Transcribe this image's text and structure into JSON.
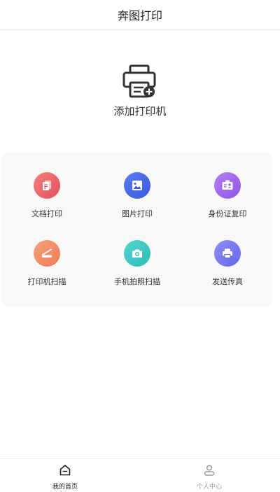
{
  "header": {
    "title": "奔图打印"
  },
  "add_printer": {
    "label": "添加打印机",
    "icon": "printer-add-icon"
  },
  "features": [
    {
      "label": "文档打印",
      "icon": "document-icon",
      "color_from": "#f77f7f",
      "color_to": "#e2505a"
    },
    {
      "label": "图片打印",
      "icon": "image-icon",
      "color_from": "#5b7cf2",
      "color_to": "#3a58de"
    },
    {
      "label": "身份证复印",
      "icon": "id-card-icon",
      "color_from": "#b57ff2",
      "color_to": "#8f55e4"
    },
    {
      "label": "打印机扫描",
      "icon": "scanner-icon",
      "color_from": "#f6a27a",
      "color_to": "#ec7c55"
    },
    {
      "label": "手机拍照扫描",
      "icon": "camera-icon",
      "color_from": "#54d6cf",
      "color_to": "#2cbcb6"
    },
    {
      "label": "发送传真",
      "icon": "fax-printer-icon",
      "color_from": "#8f8ef5",
      "color_to": "#6466ea"
    }
  ],
  "bottom_nav": {
    "home": {
      "label": "我的首页",
      "icon": "home-icon",
      "color": "#222222"
    },
    "profile": {
      "label": "个人中心",
      "icon": "user-icon",
      "color": "#9a9a9a"
    }
  }
}
